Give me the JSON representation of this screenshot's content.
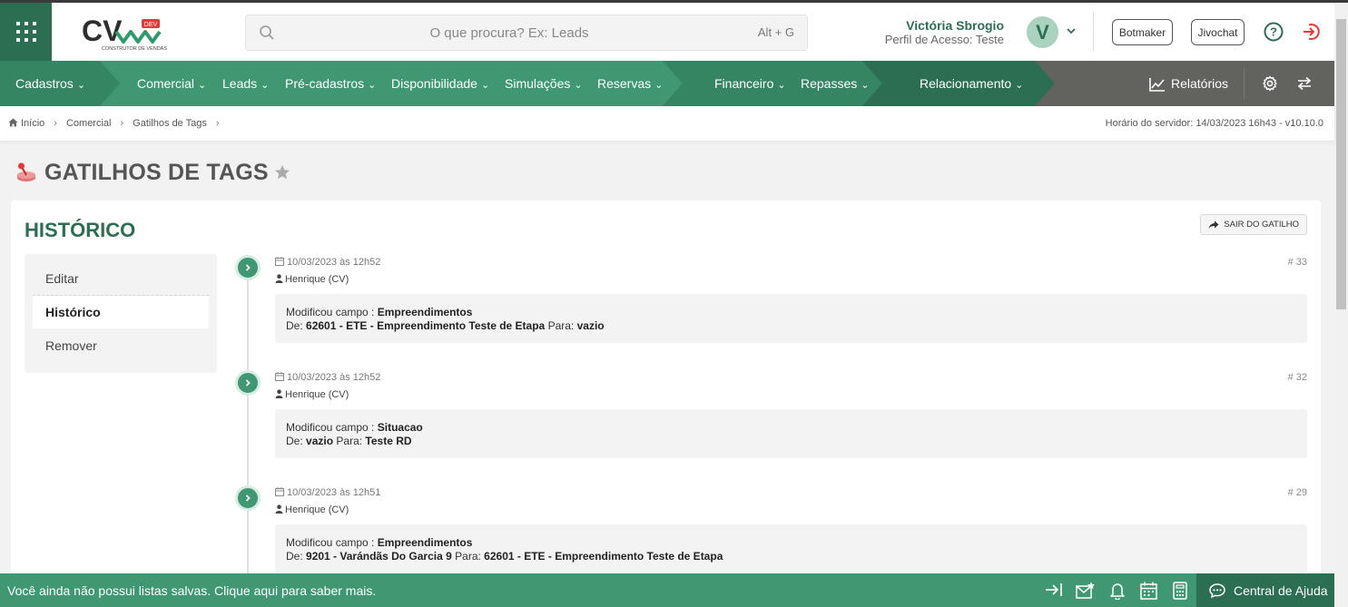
{
  "header": {
    "logo_text": "CV",
    "logo_badge": "DEV",
    "logo_subtitle": "CONSTRUTOR DE VENDAS",
    "search_placeholder": "O que procura? Ex: Leads",
    "search_shortcut": "Alt + G",
    "user_name": "Victória Sbrogio",
    "user_profile": "Perfil de Acesso: Teste",
    "avatar_initial": "V",
    "botmaker_label": "Botmaker",
    "jivochat_label": "Jivochat"
  },
  "nav": {
    "items": [
      {
        "label": "Cadastros"
      },
      {
        "label": "Comercial"
      },
      {
        "label": "Leads"
      },
      {
        "label": "Pré-cadastros"
      },
      {
        "label": "Disponibilidade"
      },
      {
        "label": "Simulações"
      },
      {
        "label": "Reservas"
      },
      {
        "label": "Financeiro"
      },
      {
        "label": "Repasses"
      },
      {
        "label": "Relacionamento"
      }
    ],
    "reports_label": "Relatórios",
    "colors": {
      "green_light": "#3f9872",
      "green_mid": "#358462",
      "green_dark": "#2c6e52",
      "gray": "#62625f"
    }
  },
  "breadcrumb": {
    "items": [
      "Início",
      "Comercial",
      "Gatilhos de Tags"
    ],
    "server_time": "Horário do servidor: 14/03/2023 16h43 - v10.10.0"
  },
  "page": {
    "title": "GATILHOS DE TAGS",
    "section_title": "HISTÓRICO",
    "exit_button": "SAIR DO GATILHO"
  },
  "side_menu": [
    {
      "label": "Editar",
      "active": false
    },
    {
      "label": "Histórico",
      "active": true
    },
    {
      "label": "Remover",
      "active": false
    }
  ],
  "history": [
    {
      "date": "10/03/2023 às 12h52",
      "author": "Henrique (CV)",
      "number": "# 33",
      "field_label": "Modificou campo :",
      "field": "Empreendimentos",
      "from_label": "De:",
      "from": "62601 - ETE - Empreendimento Teste de Etapa",
      "to_label": "Para:",
      "to": "vazio"
    },
    {
      "date": "10/03/2023 às 12h52",
      "author": "Henrique (CV)",
      "number": "# 32",
      "field_label": "Modificou campo :",
      "field": "Situacao",
      "from_label": "De:",
      "from": "vazio",
      "to_label": "Para:",
      "to": "Teste RD"
    },
    {
      "date": "10/03/2023 às 12h51",
      "author": "Henrique (CV)",
      "number": "# 29",
      "field_label": "Modificou campo :",
      "field": "Empreendimentos",
      "from_label": "De:",
      "from": "9201 - Varándãs Do Garcia 9",
      "to_label": "Para:",
      "to": "62601 - ETE - Empreendimento Teste de Etapa"
    }
  ],
  "footer": {
    "message": "Você ainda não possui listas salvas. Clique aqui para saber mais.",
    "help_center": "Central de Ajuda"
  }
}
